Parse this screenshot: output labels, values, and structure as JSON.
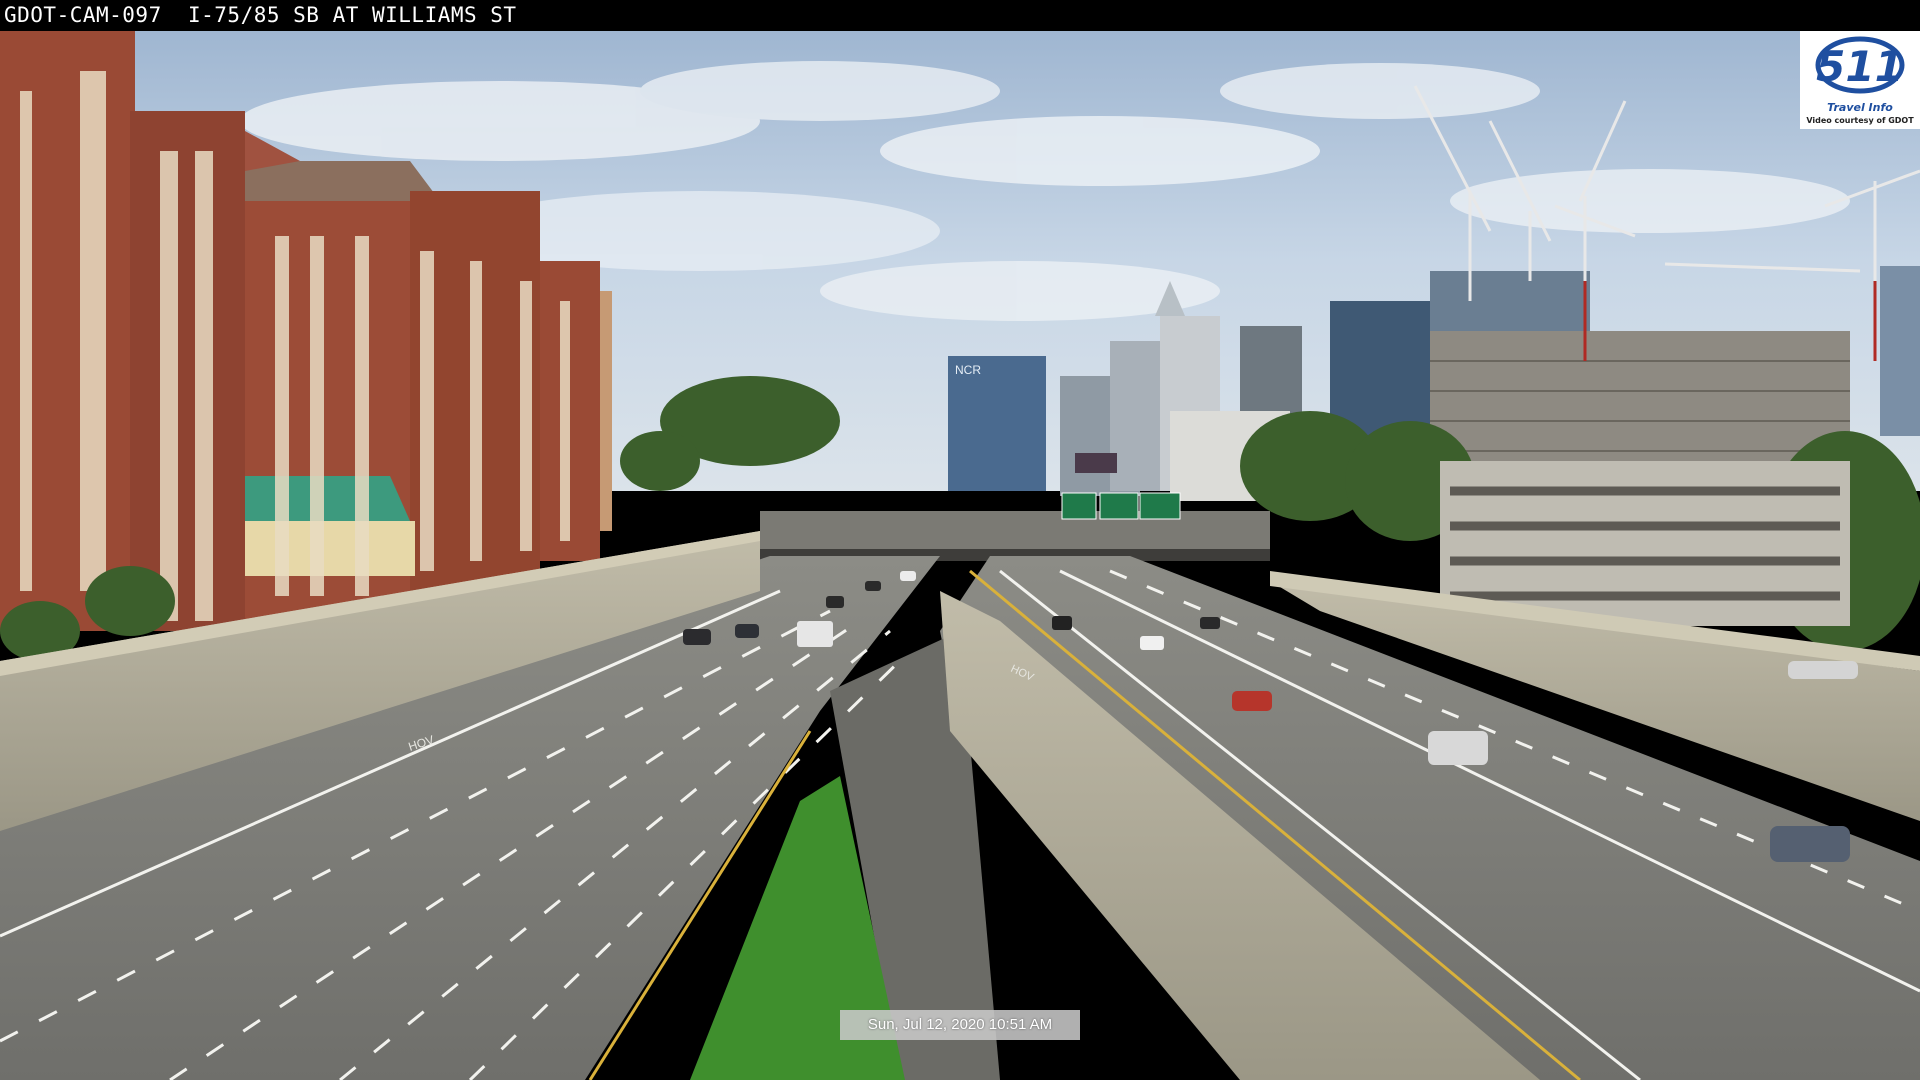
{
  "camera": {
    "title": "GDOT-CAM-097  I-75/85 SB AT WILLIAMS ST",
    "timestamp": "Sun, Jul 12, 2020  10:51 AM"
  },
  "logo": {
    "number": "511",
    "line1": "Travel Info",
    "line2": "Video courtesy of GDOT",
    "icon": "511-logo-icon"
  },
  "signs": {
    "building_logo": "NCR",
    "lane_marking_left": "HOV",
    "lane_marking_right": "HOV"
  },
  "colors": {
    "sky": "#c9d9ea",
    "brick": "#9a4a35",
    "road": "#7f7f7a",
    "wall": "#b3ae9c",
    "grass": "#3f8f2d",
    "sign_green": "#1f7a4a"
  }
}
